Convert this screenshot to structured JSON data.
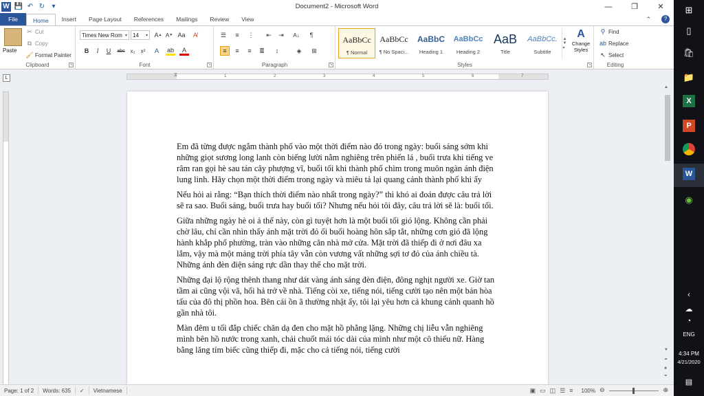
{
  "window": {
    "title": "Document2  -  Microsoft Word",
    "help": "?",
    "minimize": "—",
    "restore": "❐",
    "close": "✕"
  },
  "qat": {
    "word_icon": "W",
    "save": "💾",
    "undo": "↶",
    "redo": "↻",
    "more": "▾"
  },
  "tabs": [
    "File",
    "Home",
    "Insert",
    "Page Layout",
    "References",
    "Mailings",
    "Review",
    "View"
  ],
  "active_tab": "Home",
  "clipboard": {
    "label": "Clipboard",
    "paste": "Paste",
    "cut": "Cut",
    "copy": "Copy",
    "format_painter": "Format Painter"
  },
  "font": {
    "label": "Font",
    "name": "Times New Rom",
    "size": "14"
  },
  "paragraph": {
    "label": "Paragraph"
  },
  "styles": {
    "label": "Styles",
    "items": [
      {
        "sample": "AaBbCc",
        "name": "¶ Normal"
      },
      {
        "sample": "AaBbCc",
        "name": "¶ No Spaci..."
      },
      {
        "sample": "AaBbC",
        "name": "Heading 1"
      },
      {
        "sample": "AaBbCc",
        "name": "Heading 2"
      },
      {
        "sample": "AaB",
        "name": "Title"
      },
      {
        "sample": "AaBbCc.",
        "name": "Subtitle"
      }
    ],
    "change_styles": "Change Styles"
  },
  "editing": {
    "label": "Editing",
    "find": "Find",
    "replace": "Replace",
    "select": "Select"
  },
  "ruler": {
    "ticks": [
      "1",
      "2",
      "3",
      "4",
      "5",
      "6",
      "7"
    ]
  },
  "document": {
    "paragraphs": [
      "Em đã từng được ngắm thành phố vào một thời điểm nào đó trong ngày: buổi sáng sớm khi những giọt sương long lanh còn biếng lười nằm nghiêng trên phiến lá , buổi trưa khi tiếng ve râm ran gọi hè sau tán cây phượng vĩ, buổi tối khi thành phố chìm trong muôn ngàn ánh điện lung linh. Hãy chọn một thời điểm trong ngày và miêu tả lại quang cảnh thành phố khi ấy",
      "Nếu hỏi ai rằng: “Bạn thích thời điểm nào nhất trong ngày?” thì khó ai đoán được câu trả lời sẽ ra sao. Buổi sáng, buổi trưa hay buổi tối? Nhưng nếu hỏi tôi đây, câu trả lời sẽ là: buổi tối.",
      "Giữa những ngày hè oi ả thế này, còn gì tuyệt hơn là một buổi tối gió lộng. Không cần phải chờ lâu, chỉ cần nhìn thấy ánh mặt trời đỏ ối buổi hoàng hôn sắp tắt, những cơn gió đã lộng hành khắp phố phường, tràn vào những căn nhà mở cửa. Mặt trời đã thiếp đi ở nơi đâu xa lắm, vậy mà một mảng trời phía tây vẫn còn vương vất những sợi tơ đỏ của ánh chiều tà. Những ánh đèn điện sáng rực dần thay thế cho mặt trời.",
      "Những đại lộ rộng thênh thang như dát vàng ánh sáng đèn điện, đông nghịt người xe. Giờ tan tầm ai cũng vội vã, hối hả trở về nhà. Tiếng còi xe, tiếng nói, tiếng cười tạo nên một bản hòa tấu của đô thị phồn hoa. Bên cái ồn ã thường nhật ấy, tôi lại yêu hơn cả khung cảnh quanh hồ gần nhà tôi.",
      "Màn đêm u tối đắp chiếc chăn dạ đen cho mặt hồ phẳng lặng. Những chị liễu vẫn nghiêng mình bên hồ nước trong xanh, chải chuốt mái tóc dài của mình như một cô thiếu nữ. Hàng bằng lăng tím biếc cũng thiếp đi, mặc cho cả tiếng nói, tiếng cười"
    ]
  },
  "status": {
    "page": "Page: 1 of 2",
    "words": "Words: 635",
    "language": "Vietnamese",
    "zoom": "100%"
  },
  "taskbar": {
    "lang": "ENG",
    "time": "4:34 PM",
    "date": "4/21/2020"
  }
}
